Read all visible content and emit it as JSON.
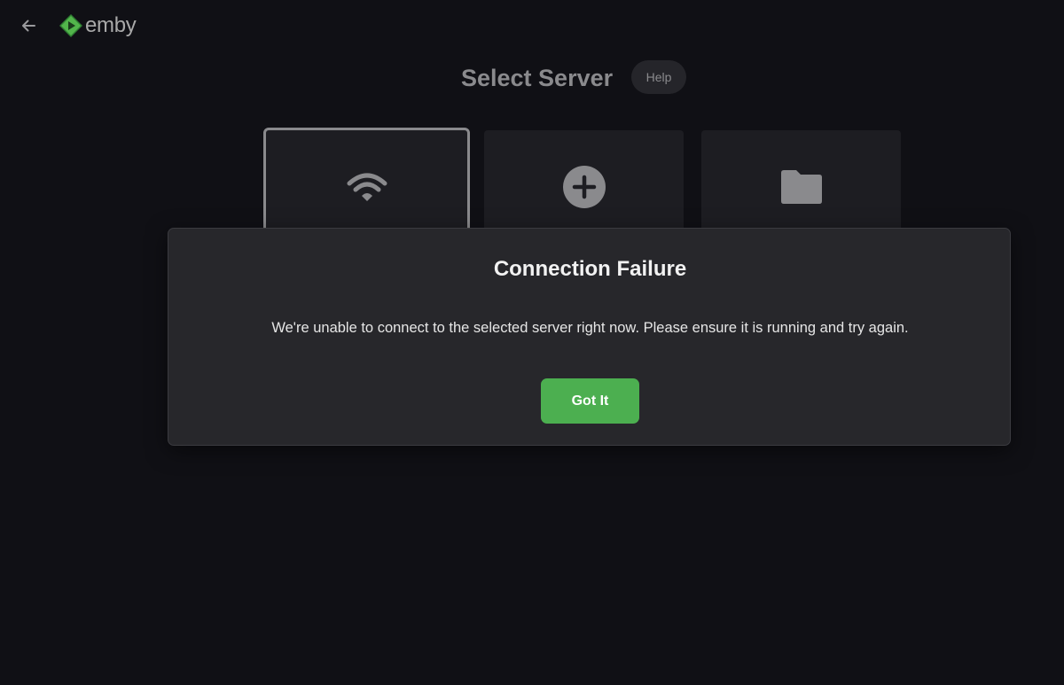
{
  "header": {
    "back_icon": "arrow-left-icon",
    "logo_icon": "emby-logo-icon",
    "logo_text": "emby"
  },
  "main": {
    "title": "Select Server",
    "help_label": "Help",
    "cards": [
      {
        "icon": "wifi-icon",
        "selected": true
      },
      {
        "icon": "plus-circle-icon",
        "selected": false
      },
      {
        "icon": "folder-icon",
        "selected": false
      }
    ]
  },
  "dialog": {
    "title": "Connection Failure",
    "message": "We're unable to connect to the selected server right now. Please ensure it is running and try again.",
    "button_label": "Got It"
  },
  "colors": {
    "background": "#101015",
    "card": "#1d1d22",
    "dialog": "#27272b",
    "accent": "#4caf50",
    "logo_green": "#52b54b",
    "muted_text": "#8a8a8d"
  }
}
